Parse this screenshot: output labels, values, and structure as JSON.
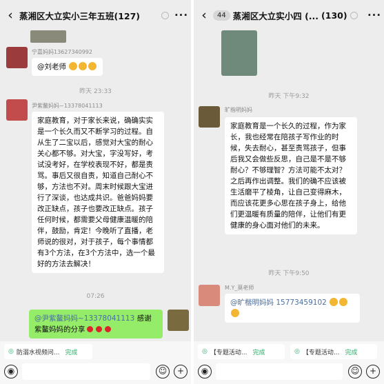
{
  "left": {
    "title": "蒸湘区大立实小三年五班(127)",
    "more": "···",
    "m1": {
      "name": "宁嘉妈妈13627340992",
      "text": "@刘老师"
    },
    "t1": "昨天 23:33",
    "m2": {
      "name": "尹紫鳌妈妈~13378041113",
      "text": "家庭教育，对于家长来说，确确实实是一个长久而又不断学习的过程。自从生了二宝以后，感觉对大宝的耐心关心都不够。对大宝，字没写好，考试没考好，在学校表现不好，都是责骂。事后又很自责，知道自己耐心不够，方法也不对。周末时候跟大宝进行了深谈，也达成共识。爸爸妈妈要改正缺点，孩子也要改正缺点。孩子任何时候，都需要父母健康温暖的陪伴，鼓励，肯定！今晚听了直播，老师说的很对，对于孩子，每个事情都有3个方法，在3个方法中，选一个最好的方法去解决！"
    },
    "t2": "07:26",
    "m3": {
      "mention": "@尹紫鳌妈妈~13378041113",
      "text": " 感谢紫鳌妈妈的分享"
    },
    "quick": {
      "label": "防溺水视频问...",
      "status": "完成"
    }
  },
  "right": {
    "badge": "44",
    "title": "蒸湘区大立实小四 (...",
    "count": "(130)",
    "more": "···",
    "t1": "昨天 下午9:32",
    "m1": {
      "name": "旷楷明妈妈",
      "text": "家庭教育是一个长久的过程，作为家长，我也经常在陪孩子写作业的时候，失去耐心，甚至责骂孩子，但事后我又会做些反思，自己是不是不够耐心？不够理智？方法可能不太对？之后再作出调整。我们的确不应该被生活磨平了棱角，让自己变得麻木，而应该花更多心思在孩子身上，给他们更温暖有质量的陪伴，让他们有更健康的身心面对他们的未来。"
    },
    "t2": "昨天 下午9:50",
    "m2": {
      "name": "M.Y_莫老师",
      "mention": "@旷楷明妈妈 ",
      "phone": "15773459102"
    },
    "quick1": {
      "label": "【专题活动...",
      "status": "完成"
    },
    "quick2": {
      "label": "【专题活动...",
      "status": "完成"
    }
  },
  "icons": [
    "back-icon",
    "more-icon",
    "voice-icon",
    "emoji-icon",
    "plus-icon",
    "thumbs-up-icon",
    "rose-icon",
    "mute-icon"
  ]
}
